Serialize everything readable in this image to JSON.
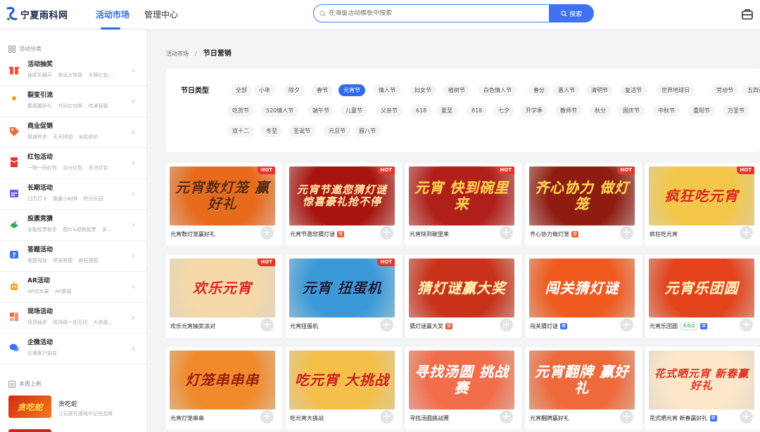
{
  "header": {
    "logo_text": "宁夏雨科网",
    "tabs": [
      {
        "label": "活动市场"
      },
      {
        "label": "管理中心"
      }
    ],
    "search_placeholder": "在海量活动模板中搜索",
    "search_button": "搜索",
    "accent_color": "#2d6bf0"
  },
  "sidebar": {
    "section_title": "活动分类",
    "items": [
      {
        "title": "活动抽奖",
        "sub": "抽奖乐翻天 幸运大转盘 天降红包...",
        "icon": "gift-icon",
        "color": "#f0583c"
      },
      {
        "title": "裂变引流",
        "sub": "集福赢好礼 齐砍红包啊 传递祝福",
        "icon": "user-icon",
        "color": "#f5a623"
      },
      {
        "title": "商业促销",
        "sub": "极速秒杀 天天拼团 全民砍价",
        "icon": "tag-icon",
        "color": "#f36a3a"
      },
      {
        "title": "红包活动",
        "sub": "一物一码红包 瓜分红包 关注红包",
        "icon": "red-envelope-icon",
        "color": "#e8342a"
      },
      {
        "title": "长期活动",
        "sub": "日历打卡 能量小树林 积分乐园",
        "icon": "calendar-icon",
        "color": "#6b5cf0"
      },
      {
        "title": "投票竞猜",
        "sub": "全能投票助手 图片&视频投票 多...",
        "icon": "vote-icon",
        "color": "#2fa75a"
      },
      {
        "title": "答题活动",
        "sub": "答题竞技 常规答题 疯狂猜图",
        "icon": "question-icon",
        "color": "#3f72f0"
      },
      {
        "title": "AR活动",
        "sub": "AR切水果 AR集福",
        "icon": "robot-icon",
        "color": "#f5a623"
      },
      {
        "title": "现场活动",
        "sub": "现场抽奖 现场摇一摇互动 大转盘...",
        "icon": "scene-icon",
        "color": "#f36a3a"
      },
      {
        "title": "企微活动",
        "sub": "企微客户裂变",
        "icon": "chat-icon",
        "color": "#3f72f0"
      }
    ],
    "new_section_title": "本周上新",
    "new_item": {
      "title": "贪吃蛇",
      "desc": "让玩家在游戏中记住品牌",
      "thumb_text": "贪吃蛇"
    }
  },
  "breadcrumb": {
    "parent": "活动市场",
    "sep": "/",
    "current": "节日营销"
  },
  "filter": {
    "label": "节日类型",
    "active": "元宵节",
    "options": [
      "全部",
      "小年",
      "除夕",
      "春节",
      "元宵节",
      "情人节",
      "妇女节",
      "植树节",
      "白色情人节",
      "春分",
      "愚人节",
      "清明节",
      "复活节",
      "世界地球日",
      "劳动节",
      "五四青年节",
      "吃货节",
      "520情人节",
      "端午节",
      "儿童节",
      "父亲节",
      "618",
      "夏至",
      "818",
      "七夕",
      "开学季",
      "教师节",
      "秋分",
      "国庆节",
      "中秋节",
      "重阳节",
      "万圣节",
      "双十二",
      "冬至",
      "圣诞节",
      "元旦节",
      "腊八节"
    ]
  },
  "cards": [
    {
      "title": "元宵数灯笼赢好礼",
      "img_text": "元宵数灯笼 赢好礼",
      "hot": true,
      "badge": "",
      "tag": "",
      "bg": "#e86a1c",
      "fg": "#5a2a0a"
    },
    {
      "title": "元宵节邀您猜灯谜",
      "img_text": "元宵节邀您猜灯谜 惊喜豪礼抢不停",
      "hot": true,
      "badge": "营",
      "tag": "",
      "bg": "#a8140f",
      "fg": "#ffe3a0"
    },
    {
      "title": "元宵快到碗里来",
      "img_text": "元宵 快到碗里来",
      "hot": true,
      "badge": "",
      "tag": "",
      "bg": "#b11f1a",
      "fg": "#ffd24a"
    },
    {
      "title": "齐心协力做灯笼",
      "img_text": "齐心协力 做灯笼",
      "hot": true,
      "badge": "营",
      "tag": "",
      "bg": "#8f1c10",
      "fg": "#ffd84a"
    },
    {
      "title": "疯狂吃元宵",
      "img_text": "疯狂吃元宵",
      "hot": true,
      "badge": "",
      "tag": "",
      "bg": "#f3c84a",
      "fg": "#d8261b"
    },
    {
      "title": "欢乐元宵抽奖派对",
      "img_text": "欢乐元宵",
      "hot": true,
      "badge": "",
      "tag": "",
      "bg": "#f6d9a8",
      "fg": "#d8261b"
    },
    {
      "title": "元宵扭蛋机",
      "img_text": "元宵 扭蛋机",
      "hot": true,
      "badge": "",
      "tag": "",
      "bg": "#3a9ad8",
      "fg": "#1a1a3a"
    },
    {
      "title": "猜灯谜赢大奖",
      "img_text": "猜灯谜赢大奖",
      "hot": false,
      "badge": "营",
      "tag": "",
      "bg": "#c8321a",
      "fg": "#fff1b0"
    },
    {
      "title": "闯关猜灯谜",
      "img_text": "闯关猜灯谜",
      "hot": false,
      "badge": "尊",
      "tag": "",
      "bg": "#f05a1e",
      "fg": "#ffffff"
    },
    {
      "title": "元宵乐团圆",
      "img_text": "元宵乐团圆",
      "hot": false,
      "badge": "尊",
      "tag": "多商品",
      "bg": "#e3421b",
      "fg": "#fff3c0"
    },
    {
      "title": "元宵灯笼串串",
      "img_text": "灯笼串串串",
      "hot": false,
      "badge": "",
      "tag": "",
      "bg": "#f08a2a",
      "fg": "#9a1a10"
    },
    {
      "title": "吃元宵大挑战",
      "img_text": "吃元宵 大挑战",
      "hot": false,
      "badge": "",
      "tag": "",
      "bg": "#f4c04a",
      "fg": "#c8201a"
    },
    {
      "title": "寻找汤圆挑战赛",
      "img_text": "寻找汤圆 挑战赛",
      "hot": false,
      "badge": "",
      "tag": "",
      "bg": "#f26d4a",
      "fg": "#ffffff"
    },
    {
      "title": "元宵翻牌赢好礼",
      "img_text": "元宵翻牌 赢好礼",
      "hot": false,
      "badge": "",
      "tag": "",
      "bg": "#ee6a3a",
      "fg": "#ffffff"
    },
    {
      "title": "花式晒元宵 新春赢好礼",
      "img_text": "花式晒元宵 新春赢好礼",
      "hot": false,
      "badge": "尊",
      "tag": "",
      "bg": "#fde7c8",
      "fg": "#e0301e"
    }
  ]
}
